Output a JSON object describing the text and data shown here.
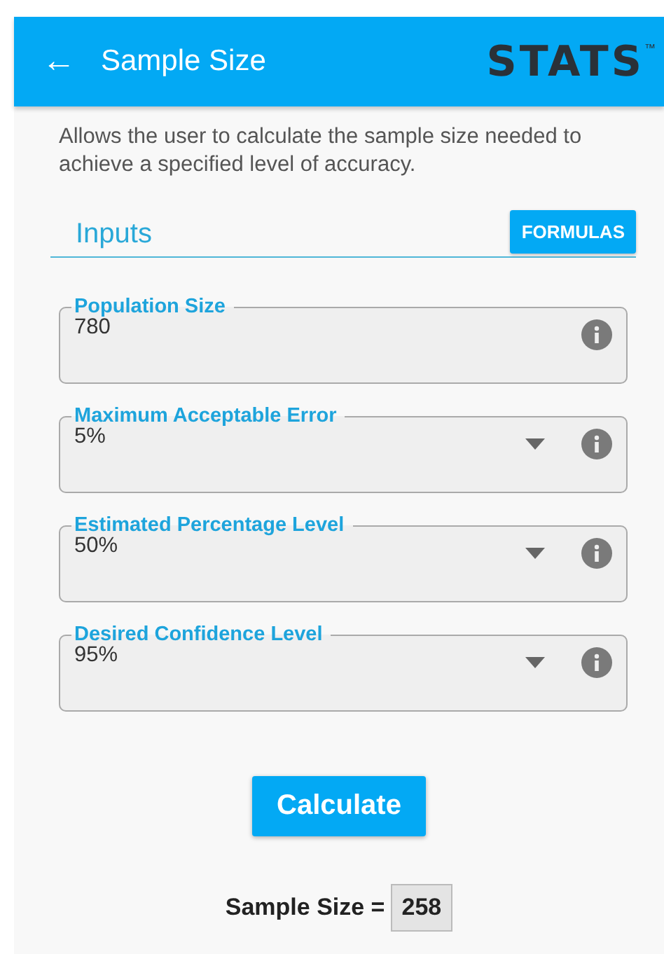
{
  "header": {
    "back_icon": "←",
    "title": "Sample Size",
    "logo": "STATS",
    "logo_mark": "™"
  },
  "description": "Allows the user to calculate the sample size needed to achieve a specified level of accuracy.",
  "section": {
    "title": "Inputs",
    "button": "FORMULAS"
  },
  "fields": [
    {
      "kind": "input",
      "label": "Population Size",
      "value": "780"
    },
    {
      "kind": "dropdown",
      "label": "Maximum Acceptable Error",
      "value": "5%"
    },
    {
      "kind": "dropdown",
      "label": "Estimated Percentage Level",
      "value": "50%"
    },
    {
      "kind": "dropdown",
      "label": "Desired Confidence Level",
      "value": "95%"
    }
  ],
  "calculate_button": "Calculate",
  "result": {
    "label": "Sample Size =",
    "value": "258"
  }
}
